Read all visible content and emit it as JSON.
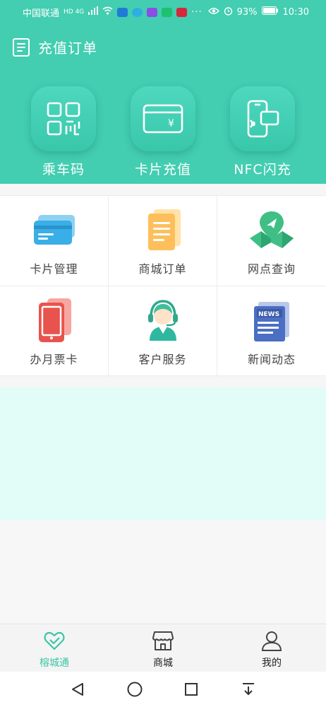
{
  "status_bar": {
    "carrier": "中国联通",
    "network": "HD 4G",
    "battery": "93%",
    "time": "10:30",
    "more": "···"
  },
  "header": {
    "title": "充值订单",
    "title_icon": "document-list-icon"
  },
  "hero_actions": [
    {
      "label": "乘车码",
      "icon": "qr-code-icon"
    },
    {
      "label": "卡片充值",
      "icon": "card-yen-icon"
    },
    {
      "label": "NFC闪充",
      "icon": "phone-nfc-icon"
    }
  ],
  "service_grid": [
    {
      "label": "卡片管理",
      "icon": "cards-icon"
    },
    {
      "label": "商城订单",
      "icon": "document-stack-icon"
    },
    {
      "label": "网点查询",
      "icon": "map-location-icon"
    },
    {
      "label": "办月票卡",
      "icon": "phone-card-icon"
    },
    {
      "label": "客户服务",
      "icon": "customer-service-icon"
    },
    {
      "label": "新闻动态",
      "icon": "newspaper-icon"
    }
  ],
  "tabs": [
    {
      "label": "榕城通",
      "icon": "heart-card-icon",
      "active": true
    },
    {
      "label": "商城",
      "icon": "store-icon",
      "active": false
    },
    {
      "label": "我的",
      "icon": "user-icon",
      "active": false
    }
  ],
  "colors": {
    "brand": "#43cdb1",
    "banner": "#e2fcf8",
    "active_tab": "#3cc5a6"
  }
}
